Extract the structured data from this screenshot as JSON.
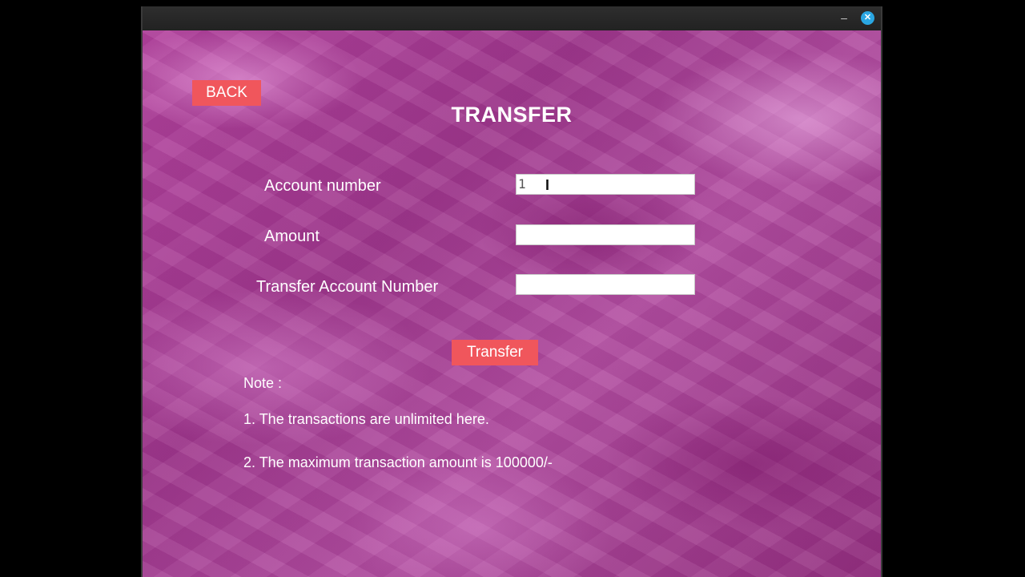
{
  "window": {
    "minimize_glyph": "–",
    "close_glyph": "✕"
  },
  "form": {
    "back_label": "BACK",
    "title": "TRANSFER",
    "account_label": "Account number",
    "account_value": "1",
    "amount_label": "Amount",
    "amount_value": "",
    "transfer_account_label": "Transfer Account Number",
    "transfer_account_value": "",
    "submit_label": "Transfer"
  },
  "notes": {
    "heading": "Note :",
    "line1": "1. The transactions are unlimited here.",
    "line2": "2. The maximum transaction amount is 100000/-"
  },
  "colors": {
    "button": "#f0565c",
    "background": "#a83d95",
    "close_icon": "#2aa6e2"
  }
}
